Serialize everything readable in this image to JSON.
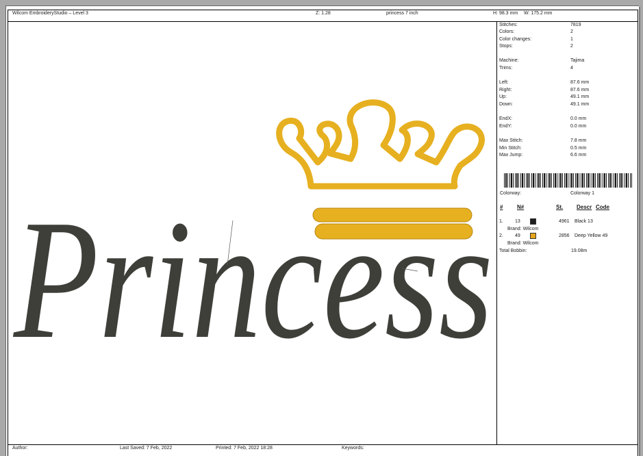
{
  "header": {
    "app_title": "Wilcom EmbroideryStudio – Level 3",
    "zoom": "Z: 1.28",
    "design_name": "princess 7 inch",
    "height": "H: 98.3 mm",
    "width": "W: 175.2 mm"
  },
  "design": {
    "word": "Princess",
    "colors": {
      "word": "#3f3f3a",
      "crown": "#e6b020",
      "crown_shadow": "#b88712"
    }
  },
  "stats": [
    {
      "label": "Stitches:",
      "value": "7819"
    },
    {
      "label": "Colors:",
      "value": "2"
    },
    {
      "label": "Color changes:",
      "value": "1"
    },
    {
      "label": "Stops:",
      "value": "2"
    },
    {
      "label": "Machine:",
      "value": "Tajima"
    },
    {
      "label": "Trims:",
      "value": "4"
    },
    {
      "label": "Left:",
      "value": "87.6 mm"
    },
    {
      "label": "Right:",
      "value": "87.6 mm"
    },
    {
      "label": "Up:",
      "value": "49.1 mm"
    },
    {
      "label": "Down:",
      "value": "49.1 mm"
    },
    {
      "label": "EndX:",
      "value": "0.0 mm"
    },
    {
      "label": "EndY:",
      "value": "0.0 mm"
    },
    {
      "label": "Max Stitch:",
      "value": "7.8 mm"
    },
    {
      "label": "Min Stitch:",
      "value": "0.5 mm"
    },
    {
      "label": "Max Jump:",
      "value": "6.6 mm"
    }
  ],
  "colorway": {
    "label": "Colorway:",
    "value": "Colorway 1"
  },
  "color_table": {
    "headers": {
      "num": "#",
      "n": "N#",
      "st": "St.",
      "descr": "Descr",
      "code": "Code"
    },
    "rows": [
      {
        "num": "1.",
        "n": "13",
        "swatch": "#1e1e1e",
        "st": "4961",
        "descr": "Black 13",
        "brand": "Brand: Wilcom"
      },
      {
        "num": "2.",
        "n": "49",
        "swatch": "#e6a51c",
        "st": "2856",
        "descr": "Deep Yellow 49",
        "brand": "Brand: Wilcom"
      }
    ],
    "total_label": "Total Bobbin:",
    "total_value": "19.08m"
  },
  "footer": {
    "author": "Author:",
    "last_saved": "Last Saved:  7 Feb, 2022",
    "printed": "Printed:  7 Feb, 2022 18:28",
    "keywords": "Keywords:"
  }
}
